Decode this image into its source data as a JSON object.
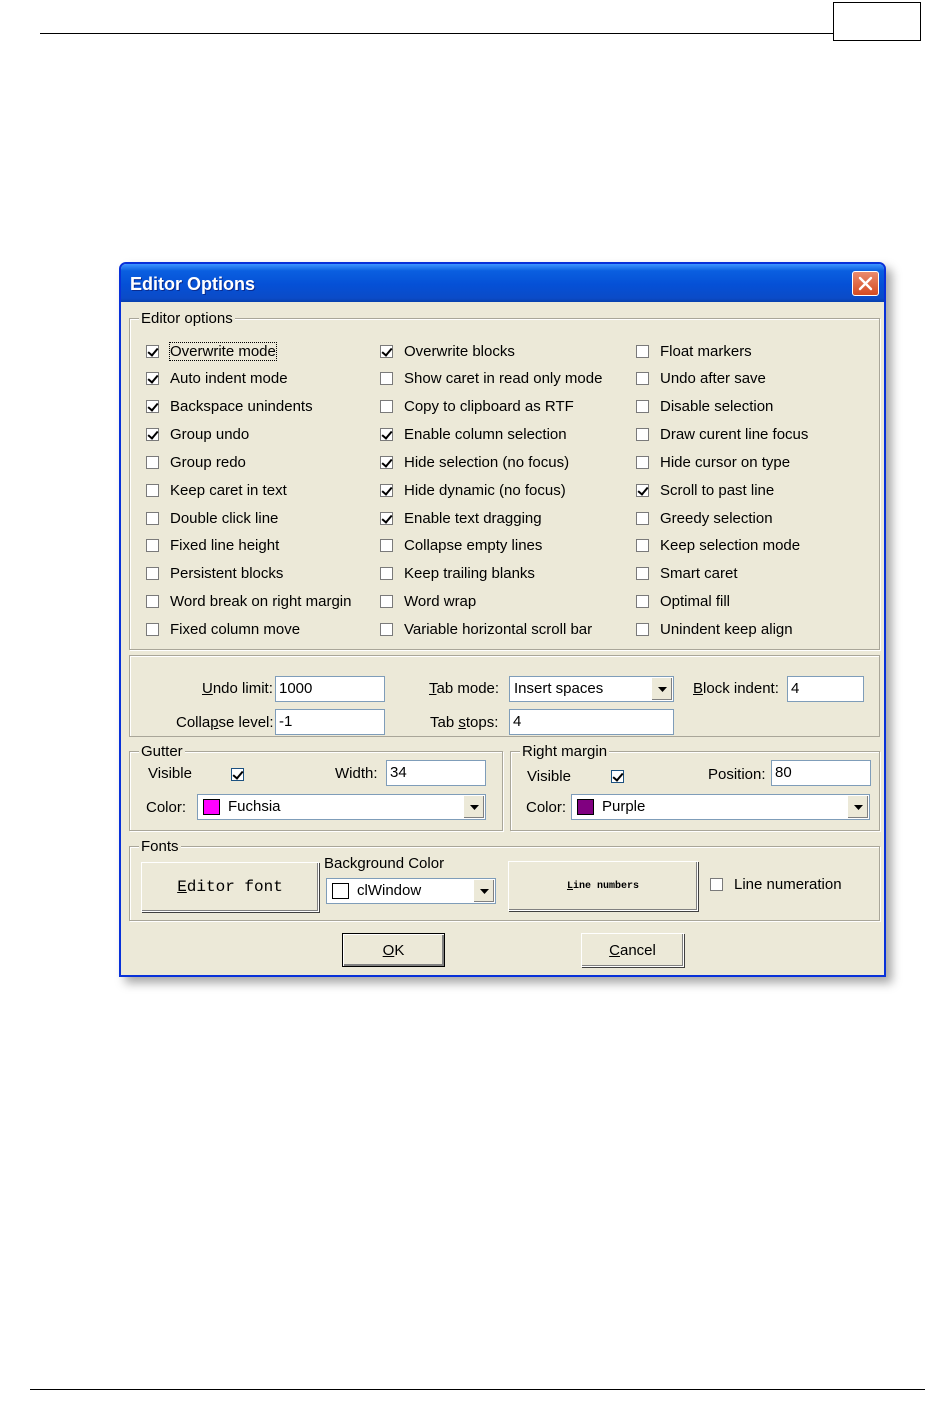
{
  "dialog": {
    "title": "Editor Options"
  },
  "editor_options": {
    "legend": "Editor options",
    "columns": [
      [
        {
          "label": "Overwrite mode",
          "checked": true,
          "focused": true
        },
        {
          "label": "Auto indent mode",
          "checked": true
        },
        {
          "label": "Backspace unindents",
          "checked": true
        },
        {
          "label": "Group undo",
          "checked": true
        },
        {
          "label": "Group redo",
          "checked": false
        },
        {
          "label": "Keep caret in text",
          "checked": false
        },
        {
          "label": "Double click line",
          "checked": false
        },
        {
          "label": "Fixed line height",
          "checked": false
        },
        {
          "label": "Persistent blocks",
          "checked": false
        },
        {
          "label": "Word break on right margin",
          "checked": false
        },
        {
          "label": "Fixed column move",
          "checked": false
        }
      ],
      [
        {
          "label": "Overwrite blocks",
          "checked": true
        },
        {
          "label": "Show caret in read only mode",
          "checked": false
        },
        {
          "label": "Copy to clipboard as RTF",
          "checked": false
        },
        {
          "label": "Enable column selection",
          "checked": true
        },
        {
          "label": "Hide selection (no focus)",
          "checked": true
        },
        {
          "label": "Hide dynamic (no focus)",
          "checked": true
        },
        {
          "label": "Enable text dragging",
          "checked": true
        },
        {
          "label": "Collapse empty lines",
          "checked": false
        },
        {
          "label": "Keep trailing blanks",
          "checked": false
        },
        {
          "label": "Word wrap",
          "checked": false
        },
        {
          "label": "Variable horizontal scroll bar",
          "checked": false
        }
      ],
      [
        {
          "label": "Float markers",
          "checked": false
        },
        {
          "label": "Undo after save",
          "checked": false
        },
        {
          "label": "Disable selection",
          "checked": false
        },
        {
          "label": "Draw curent line focus",
          "checked": false
        },
        {
          "label": "Hide cursor on type",
          "checked": false
        },
        {
          "label": "Scroll to past line",
          "checked": true
        },
        {
          "label": "Greedy selection",
          "checked": false
        },
        {
          "label": "Keep selection mode",
          "checked": false
        },
        {
          "label": "Smart caret",
          "checked": false
        },
        {
          "label": "Optimal fill",
          "checked": false
        },
        {
          "label": "Unindent keep align",
          "checked": false
        }
      ]
    ]
  },
  "settings": {
    "undo_limit": {
      "label_u": "U",
      "label_rest": "ndo limit:",
      "value": "1000"
    },
    "collapse_level": {
      "label_pre": "Colla",
      "label_u": "p",
      "label_rest": "se level:",
      "value": "-1"
    },
    "tab_mode": {
      "label_u": "T",
      "label_rest": "ab mode:",
      "value": "Insert spaces"
    },
    "tab_stops": {
      "label_pre": "Tab ",
      "label_u": "s",
      "label_rest": "tops:",
      "value": "4"
    },
    "block_indent": {
      "label_u": "B",
      "label_rest": "lock indent:",
      "value": "4"
    }
  },
  "gutter": {
    "legend": "Gutter",
    "visible_label": "Visible",
    "visible_checked": true,
    "width_label": "Width:",
    "width_value": "34",
    "color_label": "Color:",
    "color_value": "Fuchsia",
    "color_hex": "#ff00ff"
  },
  "right_margin": {
    "legend": "Right margin",
    "visible_label": "Visible",
    "visible_checked": true,
    "position_label": "Position:",
    "position_value": "80",
    "color_label": "Color:",
    "color_value": "Purple",
    "color_hex": "#800080"
  },
  "fonts": {
    "legend": "Fonts",
    "editor_font_u": "E",
    "editor_font_rest": "ditor font",
    "background_color_label": "Background Color",
    "background_color_value": "clWindow",
    "line_numbers_u": "L",
    "line_numbers_rest": "ine numbers",
    "line_numeration_label": "Line numeration",
    "line_numeration_checked": false
  },
  "buttons": {
    "ok_u": "O",
    "ok_rest": "K",
    "cancel_u": "C",
    "cancel_rest": "ancel"
  }
}
